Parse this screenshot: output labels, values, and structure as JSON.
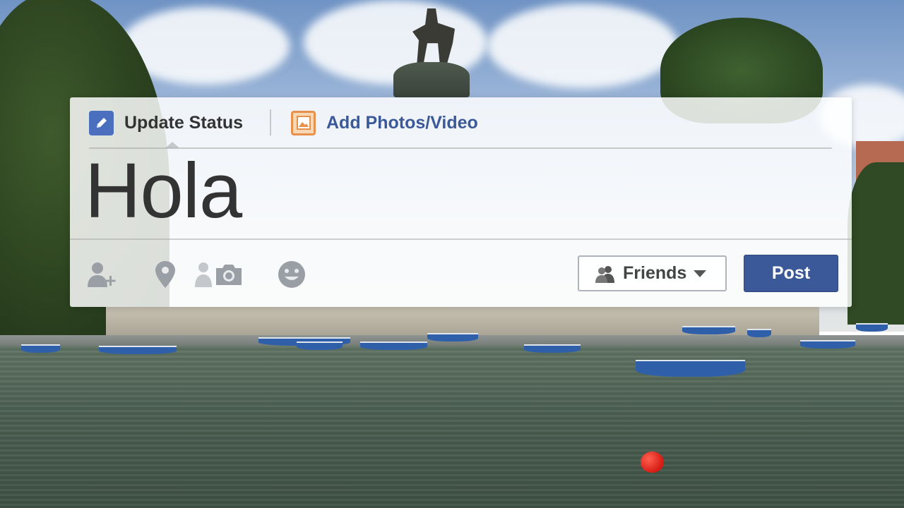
{
  "composer": {
    "tabs": [
      {
        "label": "Update Status",
        "icon": "pencil-icon",
        "active": true
      },
      {
        "label": "Add Photos/Video",
        "icon": "photo-icon",
        "active": false
      }
    ],
    "status_text": "Hola",
    "toolbar": {
      "icons": [
        "tag-friends-icon",
        "location-icon",
        "person-icon",
        "camera-icon",
        "smiley-icon"
      ],
      "audience_label": "Friends",
      "audience_icon": "friends-icon",
      "post_label": "Post"
    }
  },
  "colors": {
    "brand": "#3b5998",
    "post_button": "#3b5998",
    "photo_icon_accent": "#e8914a",
    "status_icon_accent": "#4a6fbf"
  }
}
